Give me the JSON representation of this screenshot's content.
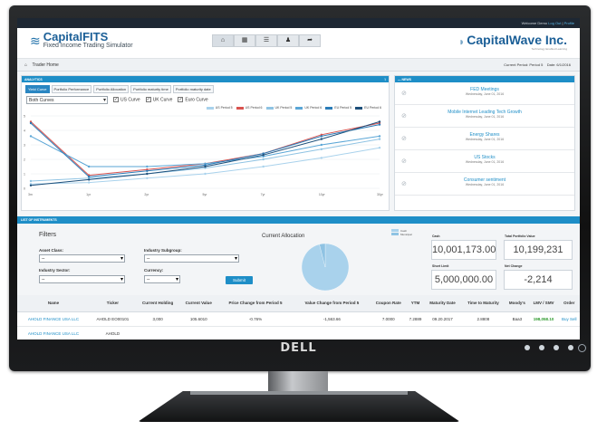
{
  "topbar": {
    "welcome": "Welcome",
    "user": "Demo",
    "logout": "Log Out",
    "profile": "Profile",
    "sep": " | "
  },
  "logo": {
    "name": "CapitalFITS",
    "subtitle": "Fixed Income Trading Simulator"
  },
  "nav": {
    "icons": [
      "home-icon",
      "calculator-icon",
      "list-icon",
      "users-icon",
      "share-icon"
    ]
  },
  "brand_right": {
    "name": "CapitalWave Inc.",
    "tagline": "Technology Enabled Learning"
  },
  "breadcrumb": {
    "page": "Trader Home",
    "current_period": "Current Period: Period 5",
    "date": "Date: 6/1/2016"
  },
  "analytics": {
    "title": "ANALYTICS",
    "tabs": [
      "Yield Curve",
      "Portfolio Performance",
      "Portfolio Allocation",
      "Portfolio maturity time",
      "Portfolio maturity date"
    ],
    "curve_select": "Both Curves",
    "checks": [
      "US Curve",
      "UK Curve",
      "Euro Curve"
    ],
    "legend": [
      "US Period 5",
      "US Period 6",
      "UK Period 5",
      "UK Period 6",
      "EU Period 5",
      "EU Period 6"
    ]
  },
  "chart_data": {
    "type": "line",
    "categories": [
      "3m",
      "1yr",
      "2yr",
      "5yr",
      "7yr",
      "10yr",
      "30yr"
    ],
    "ylim": [
      0,
      5
    ],
    "series": [
      {
        "name": "US Period 5",
        "color": "#a9d2ec",
        "values": [
          0.3,
          0.4,
          0.7,
          1.0,
          1.5,
          2.1,
          2.8
        ]
      },
      {
        "name": "US Period 6",
        "color": "#d9534f",
        "values": [
          4.6,
          0.9,
          1.3,
          1.7,
          2.4,
          3.7,
          4.5
        ]
      },
      {
        "name": "UK Period 5",
        "color": "#8fc3e3",
        "values": [
          0.5,
          0.7,
          1.0,
          1.4,
          2.0,
          2.7,
          3.4
        ]
      },
      {
        "name": "UK Period 6",
        "color": "#5aa6d6",
        "values": [
          3.6,
          1.5,
          1.5,
          1.7,
          2.2,
          3.0,
          3.6
        ]
      },
      {
        "name": "EU Period 5",
        "color": "#2a7cb8",
        "values": [
          4.5,
          0.8,
          1.2,
          1.6,
          2.4,
          3.6,
          4.4
        ]
      },
      {
        "name": "EU Period 6",
        "color": "#1d4f7a",
        "values": [
          0.2,
          0.6,
          1.0,
          1.5,
          2.3,
          3.4,
          4.6
        ]
      }
    ]
  },
  "news": {
    "title": "NEWS",
    "items": [
      {
        "headline": "FED Meetings",
        "date": "Wednesday, June 01, 2016"
      },
      {
        "headline": "Mobile Internet Leading Tech Growth",
        "date": "Wednesday, June 01, 2016"
      },
      {
        "headline": "Energy Shares",
        "date": "Wednesday, June 01, 2016"
      },
      {
        "headline": "US Stocks",
        "date": "Wednesday, June 01, 2016"
      },
      {
        "headline": "Consumer sentiment",
        "date": "Wednesday, June 01, 2016"
      }
    ]
  },
  "instruments": {
    "title": "LIST OF INSTRUMENTS",
    "filters_title": "Filters",
    "asset_class": "Asset Class:",
    "industry_subgroup": "Industry Subgroup:",
    "industry_sector": "Industry Sector:",
    "currency": "Currency:",
    "placeholder": "--",
    "submit": "Submit",
    "allocation_title": "Current Allocation",
    "alloc_legend": [
      "Cash",
      "Municipal"
    ],
    "alloc_values": [
      96,
      4
    ],
    "cash_label": "Cash",
    "cash_value": "10,001,173.00",
    "tpv_label": "Total Portfolio Value",
    "tpv_value": "10,199,231",
    "shortlimit_label": "Short Limit",
    "shortlimit_value": "5,000,000.00",
    "netchange_label": "Net Change",
    "netchange_value": "-2,214"
  },
  "table": {
    "headers": [
      "Name",
      "Ticker",
      "Current Holding",
      "Current Value",
      "Price Change from Period 5",
      "Value Change from Period 5",
      "Coupon Rate",
      "YTM",
      "Maturity Date",
      "Time to Maturity",
      "Moody's",
      "LMV / SMV",
      "Order"
    ],
    "rows": [
      [
        "AHOLD FINANCE USA LLC",
        "AHOLD EO00101",
        "3,000",
        "105.6010",
        "-0.76%",
        "-1,563.66",
        "7.0000",
        "7.2889",
        "09.20.2017",
        "2.8808",
        "Baa3",
        "198,058.10",
        "Buy Sell"
      ],
      [
        "AHOLD FINANCE USA LLC",
        "AHOLD",
        "",
        "",
        "",
        "",
        "",
        "",
        "",
        "",
        "",
        "",
        ""
      ]
    ]
  }
}
